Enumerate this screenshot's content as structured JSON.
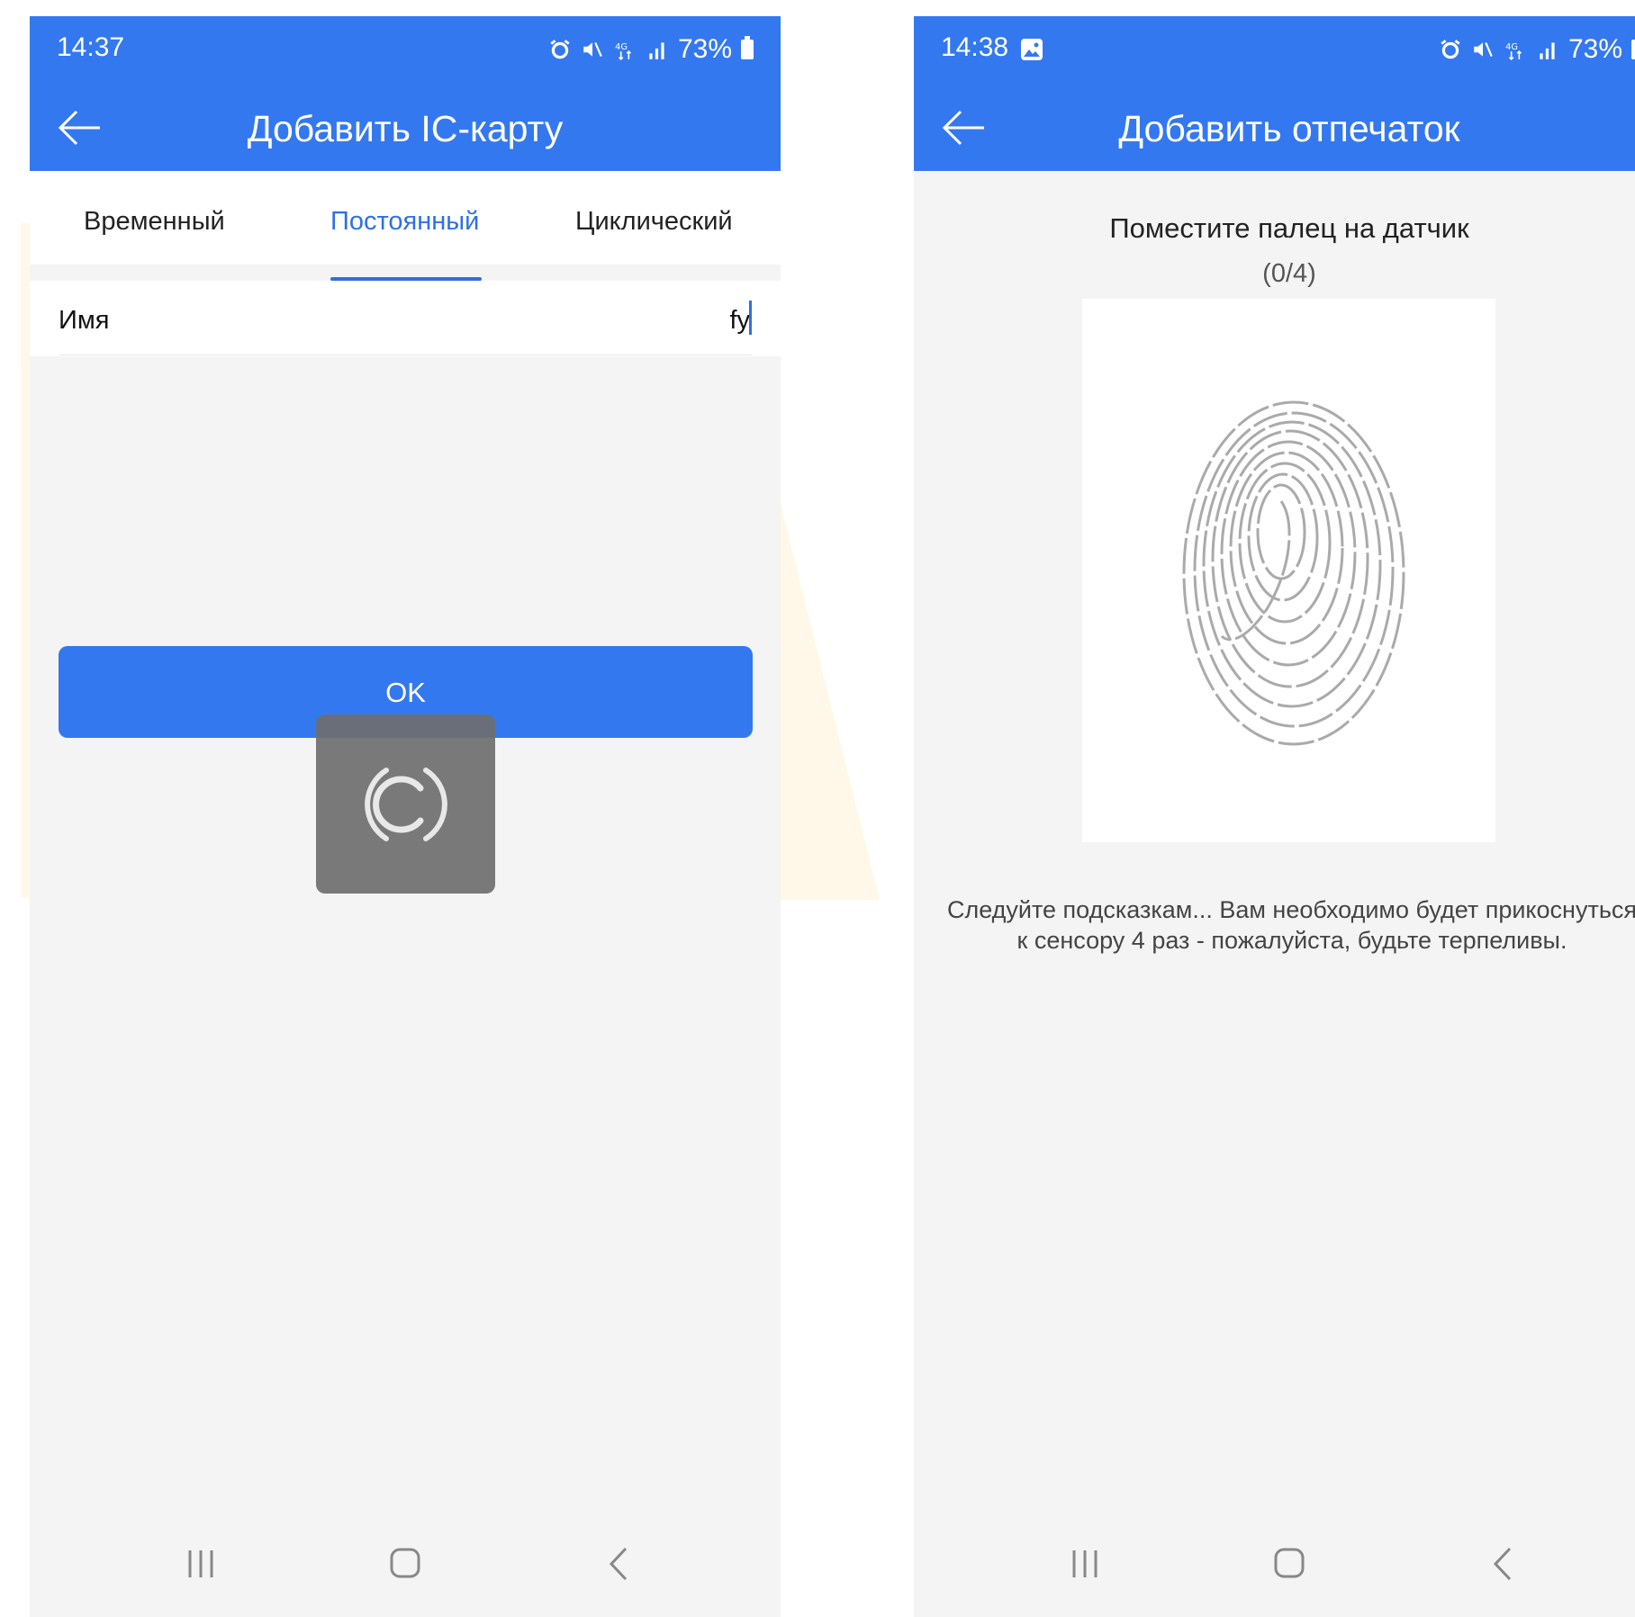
{
  "left": {
    "status": {
      "time": "14:37",
      "battery": "73%"
    },
    "title": "Добавить IC-карту",
    "tabs": [
      {
        "label": "Временный",
        "active": false
      },
      {
        "label": "Постоянный",
        "active": true
      },
      {
        "label": "Циклический",
        "active": false
      }
    ],
    "name_field": {
      "label": "Имя",
      "value": "fy"
    },
    "ok_label": "OK"
  },
  "right": {
    "status": {
      "time": "14:38",
      "battery": "73%"
    },
    "title": "Добавить отпечаток",
    "prompt": "Поместите палец на датчик",
    "progress": "(0/4)",
    "hint_line1": "Следуйте подсказкам... Вам необходимо будет прикоснуться",
    "hint_line2": "к сенсору 4 раз - пожалуйста, будьте терпеливы."
  },
  "colors": {
    "accent": "#3478f0",
    "tab_active": "#2f6fe6",
    "background": "#f4f4f4"
  }
}
